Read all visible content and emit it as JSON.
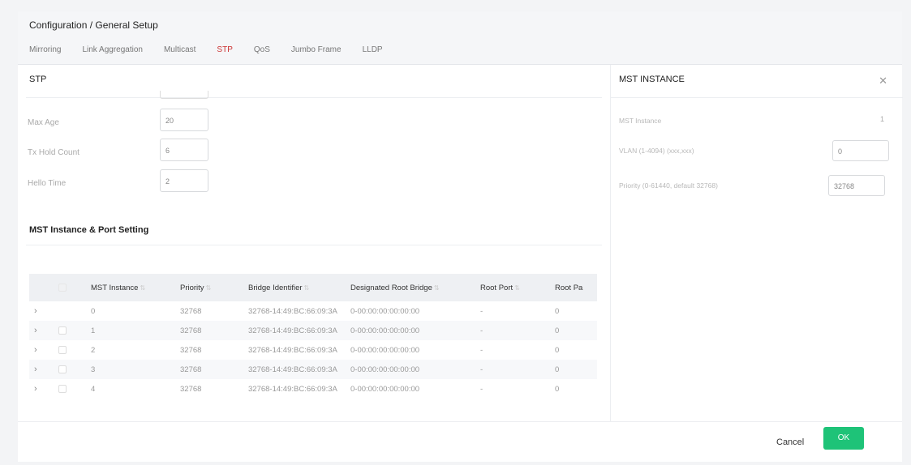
{
  "breadcrumb": "Configuration / General Setup",
  "tabs": [
    {
      "label": "Mirroring",
      "active": false
    },
    {
      "label": "Link Aggregation",
      "active": false
    },
    {
      "label": "Multicast",
      "active": false
    },
    {
      "label": "STP",
      "active": true
    },
    {
      "label": "QoS",
      "active": false
    },
    {
      "label": "Jumbo Frame",
      "active": false
    },
    {
      "label": "LLDP",
      "active": false
    }
  ],
  "stp": {
    "title": "STP",
    "fields": [
      {
        "label": "Max Age",
        "value": "20"
      },
      {
        "label": "Tx Hold Count",
        "value": "6"
      },
      {
        "label": "Hello Time",
        "value": "2"
      }
    ]
  },
  "mst_section": {
    "title": "MST Instance & Port Setting",
    "columns": [
      "MST Instance",
      "Priority",
      "Bridge Identifier",
      "Designated Root Bridge",
      "Root Port",
      "Root Pa"
    ],
    "rows": [
      {
        "instance": "0",
        "priority": "32768",
        "bridge": "32768-14:49:BC:66:09:3A",
        "droot": "0-00:00:00:00:00:00",
        "rport": "-",
        "rpath": "0",
        "checkbox": false
      },
      {
        "instance": "1",
        "priority": "32768",
        "bridge": "32768-14:49:BC:66:09:3A",
        "droot": "0-00:00:00:00:00:00",
        "rport": "-",
        "rpath": "0",
        "checkbox": true
      },
      {
        "instance": "2",
        "priority": "32768",
        "bridge": "32768-14:49:BC:66:09:3A",
        "droot": "0-00:00:00:00:00:00",
        "rport": "-",
        "rpath": "0",
        "checkbox": true
      },
      {
        "instance": "3",
        "priority": "32768",
        "bridge": "32768-14:49:BC:66:09:3A",
        "droot": "0-00:00:00:00:00:00",
        "rport": "-",
        "rpath": "0",
        "checkbox": true
      },
      {
        "instance": "4",
        "priority": "32768",
        "bridge": "32768-14:49:BC:66:09:3A",
        "droot": "0-00:00:00:00:00:00",
        "rport": "-",
        "rpath": "0",
        "checkbox": true
      }
    ]
  },
  "mst_panel": {
    "title": "MST INSTANCE",
    "instance_label": "MST Instance",
    "instance_value": "1",
    "vlan_label": "VLAN (1-4094) (xxx,xxx)",
    "vlan_value": "0",
    "priority_label": "Priority (0-61440, default 32768)",
    "priority_value": "32768"
  },
  "footer": {
    "cancel": "Cancel",
    "ok": "OK"
  },
  "colors": {
    "accent_tab": "#d33333",
    "ok_button": "#1ec378"
  },
  "icons": {
    "close": "close-icon",
    "expand": "chevron-right-icon",
    "sort": "sort-icon"
  }
}
